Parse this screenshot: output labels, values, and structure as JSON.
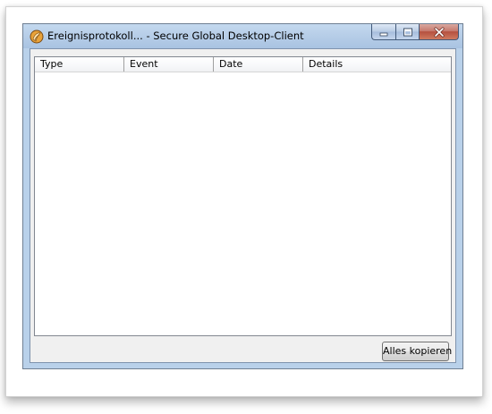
{
  "window": {
    "title": "Ereignisprotokoll... - Secure Global Desktop-Client",
    "icon": "app-logo-icon",
    "caption_buttons": [
      "minimize-icon",
      "maximize-icon",
      "close-icon"
    ]
  },
  "event_list": {
    "columns": [
      "Type",
      "Event",
      "Date",
      "Details"
    ],
    "rows": []
  },
  "actions": {
    "copy_all_label": "Alles kopieren"
  }
}
